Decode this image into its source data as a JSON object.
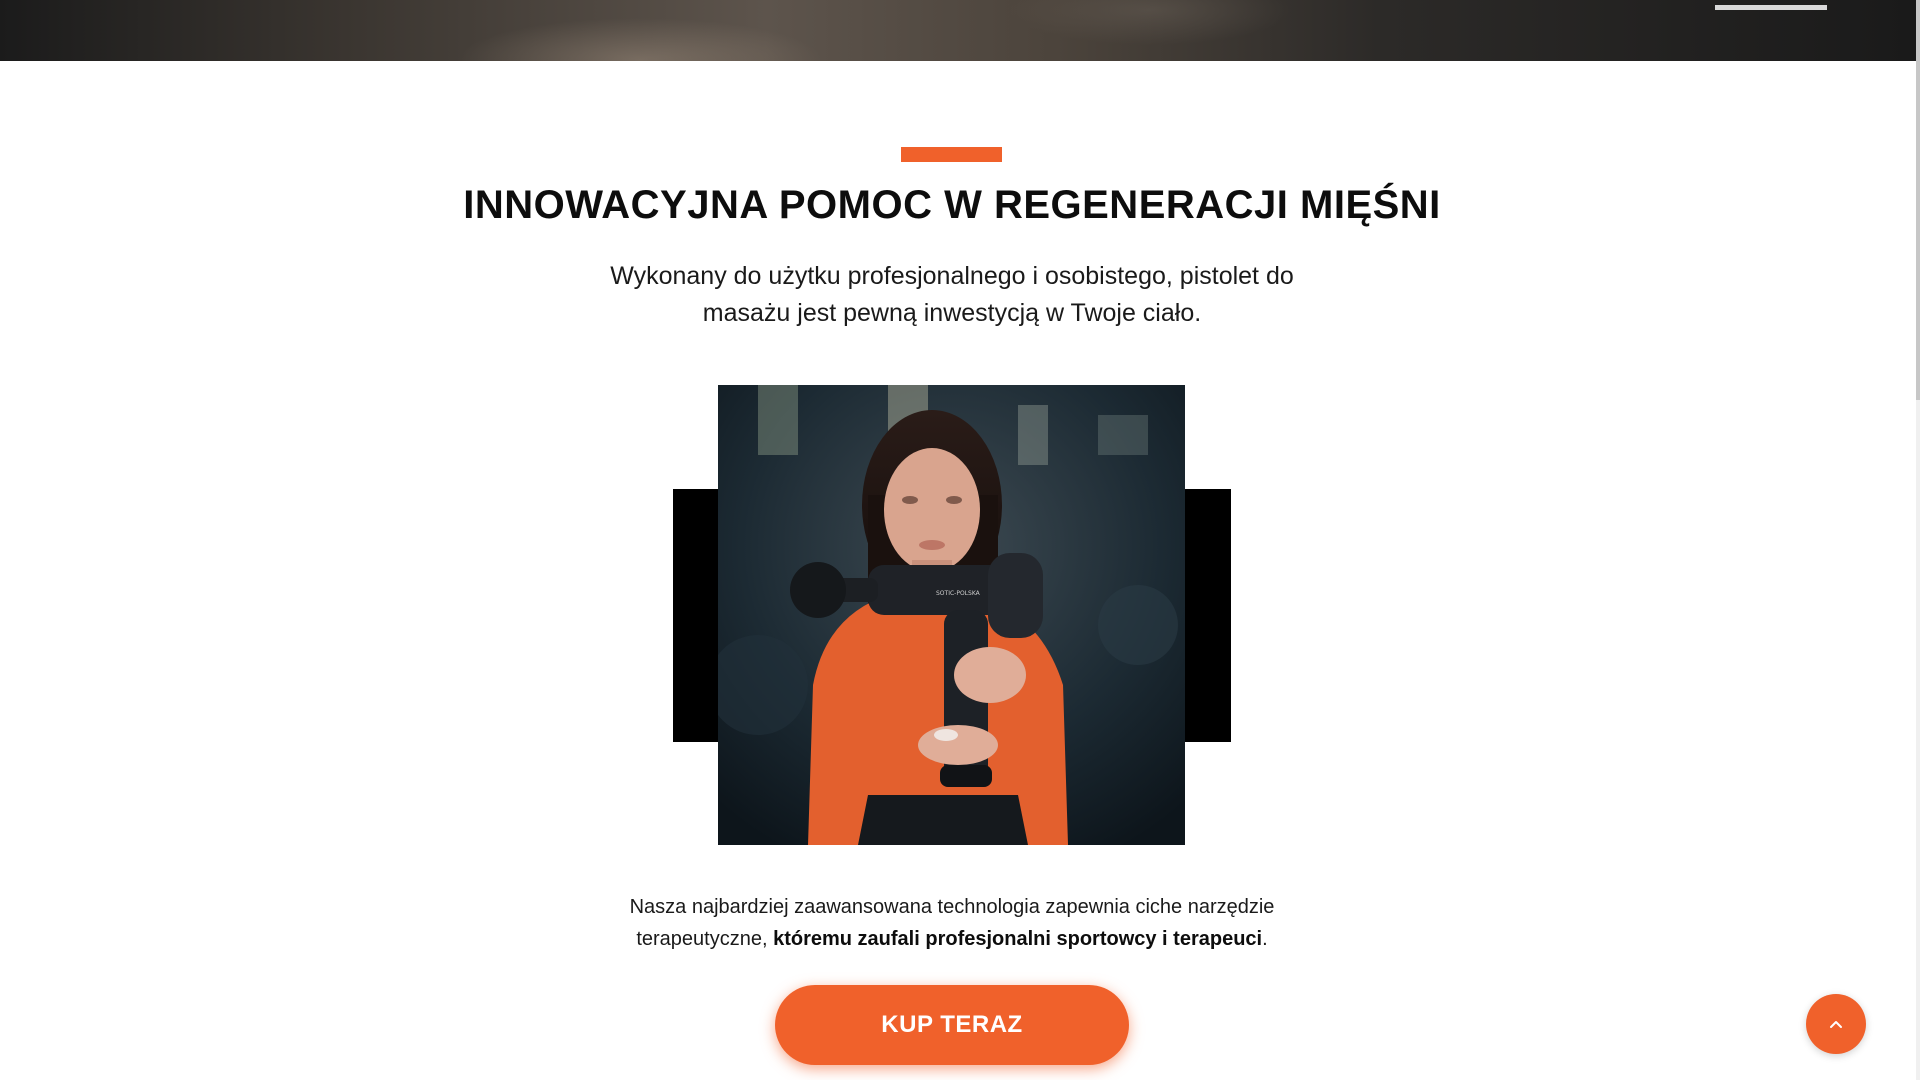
{
  "hero": {
    "slider_indicator": "active-slide-bar"
  },
  "section": {
    "title": "INNOWACYJNA POMOC W REGENERACJI MIĘŚNI",
    "subtitle_line1": "Wykonany do użytku profesjonalnego i osobistego, pistolet do",
    "subtitle_line2": "masażu jest pewną inwestycją w Twoje ciało.",
    "body_text_plain": "Nasza najbardziej zaawansowana technologia zapewnia ciche narzędzie terapeutyczne,",
    "body_text_bold": "któremu zaufali profesjonalni sportowcy i terapeuci",
    "body_text_end": ".",
    "cta_label": "KUP TERAZ",
    "photo_brand_text": "SOTIC-POLSKA"
  },
  "ui": {
    "back_to_top_icon": "chevron-up-icon"
  },
  "colors": {
    "accent": "#f0612b",
    "text": "#111111",
    "frame": "#000000"
  }
}
